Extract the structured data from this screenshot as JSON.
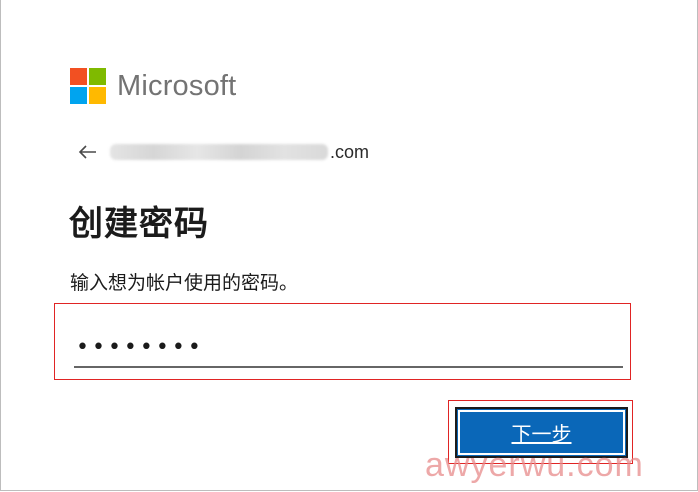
{
  "brand": {
    "name": "Microsoft",
    "logo_colors": [
      "#f25022",
      "#7fba00",
      "#00a4ef",
      "#ffb900"
    ]
  },
  "identity": {
    "back_icon": "arrow-left-icon",
    "email_domain": ".com"
  },
  "page": {
    "title": "创建密码",
    "subtitle": "输入想为帐户使用的密码。"
  },
  "password_field": {
    "masked_value": "••••••••"
  },
  "actions": {
    "next_label": "下一步",
    "accent_color": "#0a67b8"
  },
  "watermark": {
    "text": "awyerwu.com"
  }
}
